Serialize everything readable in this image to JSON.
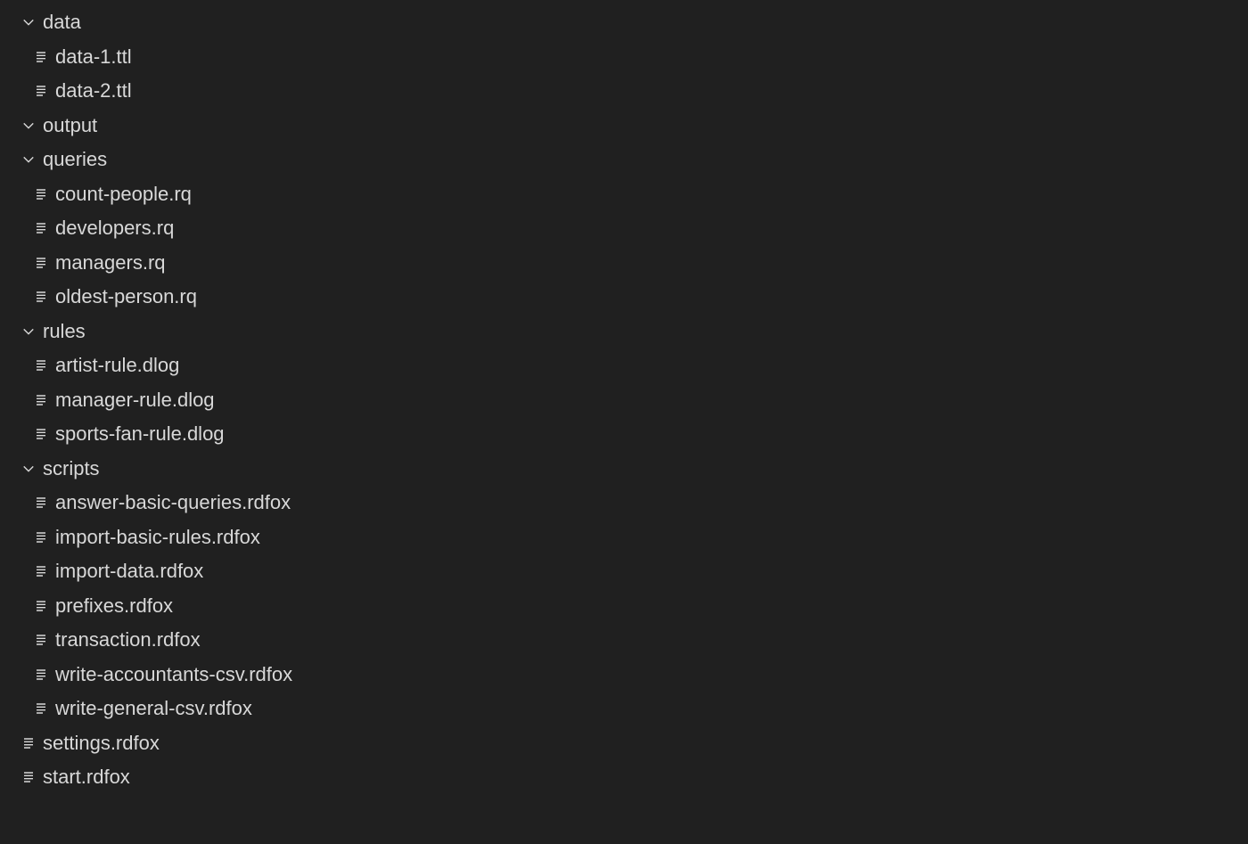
{
  "tree": {
    "folders": [
      {
        "name": "data",
        "expanded": true,
        "files": [
          "data-1.ttl",
          "data-2.ttl"
        ]
      },
      {
        "name": "output",
        "expanded": true,
        "files": []
      },
      {
        "name": "queries",
        "expanded": true,
        "files": [
          "count-people.rq",
          "developers.rq",
          "managers.rq",
          "oldest-person.rq"
        ]
      },
      {
        "name": "rules",
        "expanded": true,
        "files": [
          "artist-rule.dlog",
          "manager-rule.dlog",
          "sports-fan-rule.dlog"
        ]
      },
      {
        "name": "scripts",
        "expanded": true,
        "files": [
          "answer-basic-queries.rdfox",
          "import-basic-rules.rdfox",
          "import-data.rdfox",
          "prefixes.rdfox",
          "transaction.rdfox",
          "write-accountants-csv.rdfox",
          "write-general-csv.rdfox"
        ]
      }
    ],
    "rootFiles": [
      "settings.rdfox",
      "start.rdfox"
    ]
  },
  "colors": {
    "background": "#202020",
    "text": "#d8d8d8"
  }
}
